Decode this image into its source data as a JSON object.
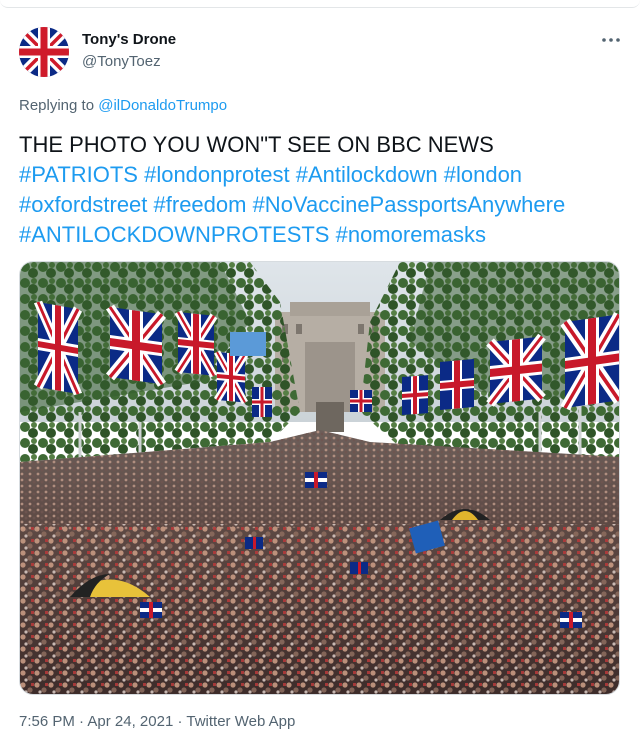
{
  "tweet": {
    "author": {
      "display_name": "Tony's Drone",
      "handle": "@TonyToez",
      "avatar_icon": "union-jack-flag-icon"
    },
    "more_icon": "ellipsis-icon",
    "reply": {
      "prefix": "Replying to",
      "mention": "@ilDonaldoTrumpo"
    },
    "text": {
      "line1": "THE PHOTO YOU WON\"T SEE ON BBC NEWS",
      "line2": "#PATRIOTS #londonprotest #Antilockdown #london",
      "line3": "#oxfordstreet #freedom #NoVaccinePassportsAnywhere",
      "line4": "#ANTILOCKDOWNPROTESTS  #nomoremasks"
    },
    "media": {
      "kind": "photo",
      "subject": "crowd-with-union-jack-flags"
    },
    "meta": {
      "time": "7:56 PM",
      "separator": "·",
      "date": "Apr 24, 2021",
      "source": "Twitter Web App"
    }
  },
  "colors": {
    "link": "#1d9bf0",
    "text": "#0f1419",
    "secondary_text": "#536471",
    "border": "#d7dce0"
  }
}
